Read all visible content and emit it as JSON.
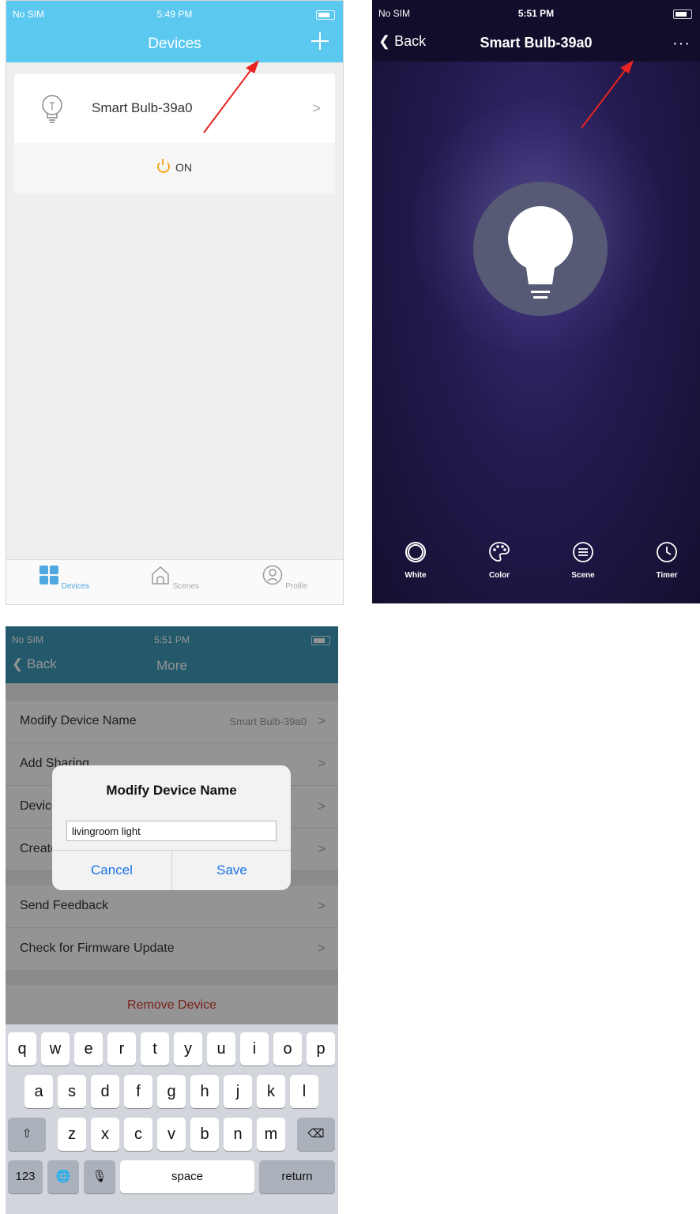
{
  "screen1": {
    "status": {
      "carrier": "No SIM",
      "time": "5:49 PM"
    },
    "title": "Devices",
    "device": {
      "name": "Smart Bulb-39a0",
      "power_label": "ON"
    },
    "tabs": [
      {
        "label": "Devices",
        "icon": "grid-icon"
      },
      {
        "label": "Scenes",
        "icon": "home-icon"
      },
      {
        "label": "Profile",
        "icon": "profile-icon"
      }
    ],
    "accent": "#5bc8f0"
  },
  "screen2": {
    "status": {
      "carrier": "No SIM",
      "time": "5:51 PM"
    },
    "back_label": "Back",
    "title": "Smart Bulb-39a0",
    "more_label": "···",
    "modes": [
      {
        "label": "White",
        "icon": "white-ring-icon"
      },
      {
        "label": "Color",
        "icon": "palette-icon"
      },
      {
        "label": "Scene",
        "icon": "scene-list-icon"
      },
      {
        "label": "Timer",
        "icon": "clock-icon"
      }
    ]
  },
  "screen3": {
    "status": {
      "carrier": "No SIM",
      "time": "5:51 PM"
    },
    "back_label": "Back",
    "title": "More",
    "items": [
      {
        "label": "Modify Device Name",
        "value": "Smart Bulb-39a0"
      },
      {
        "label": "Add Sharing",
        "value": ""
      },
      {
        "label": "Device Info",
        "value": ""
      },
      {
        "label": "Create Group",
        "value": ""
      },
      {
        "label": "Send Feedback",
        "value": ""
      },
      {
        "label": "Check for Firmware Update",
        "value": ""
      }
    ],
    "remove_label": "Remove Device",
    "dialog": {
      "title": "Modify Device Name",
      "input_value": "livingroom light",
      "cancel_label": "Cancel",
      "save_label": "Save"
    },
    "keyboard": {
      "row1": [
        "q",
        "w",
        "e",
        "r",
        "t",
        "y",
        "u",
        "i",
        "o",
        "p"
      ],
      "row2": [
        "a",
        "s",
        "d",
        "f",
        "g",
        "h",
        "j",
        "k",
        "l"
      ],
      "row3": [
        "z",
        "x",
        "c",
        "v",
        "b",
        "n",
        "m"
      ],
      "numbers_label": "123",
      "space_label": "space",
      "return_label": "return"
    }
  }
}
